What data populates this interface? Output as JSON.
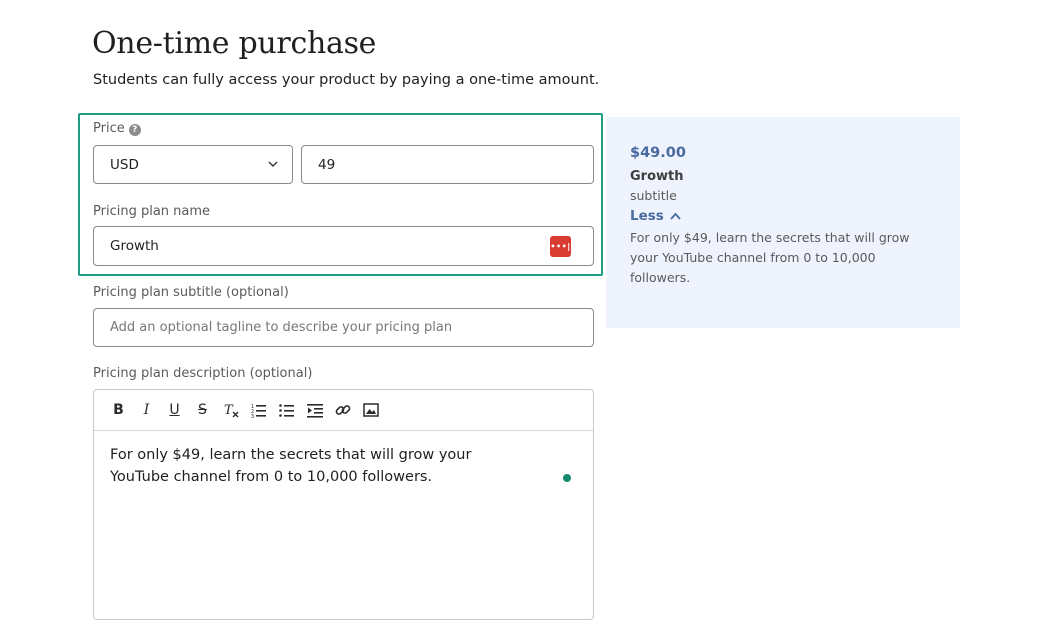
{
  "header": {
    "title": "One-time purchase",
    "subtitle": "Students can fully access your product by paying a one-time amount."
  },
  "form": {
    "price_label": "Price",
    "currency_value": "USD",
    "price_value": "49",
    "plan_name_label": "Pricing plan name",
    "plan_name_value": "Growth",
    "plan_subtitle_label": "Pricing plan subtitle (optional)",
    "plan_subtitle_placeholder": "Add an optional tagline to describe your pricing plan",
    "plan_description_label": "Pricing plan description (optional)",
    "plan_description_value": "For only $49, learn the secrets that will grow your YouTube channel from 0 to 10,000 followers."
  },
  "toolbar": {
    "bold": "B",
    "italic": "I",
    "underline": "U",
    "strike": "S"
  },
  "preview": {
    "price": "$49.00",
    "name": "Growth",
    "subtitle": "subtitle",
    "toggle_label": "Less",
    "description": "For only $49, learn the secrets that will grow your YouTube channel from 0 to 10,000 followers."
  },
  "colors": {
    "highlight": "#1f9e86",
    "preview_bg": "#eef3fd",
    "accent_text": "#4a6aa0",
    "password_manager": "#d93a31",
    "status_dot": "#168a70"
  }
}
